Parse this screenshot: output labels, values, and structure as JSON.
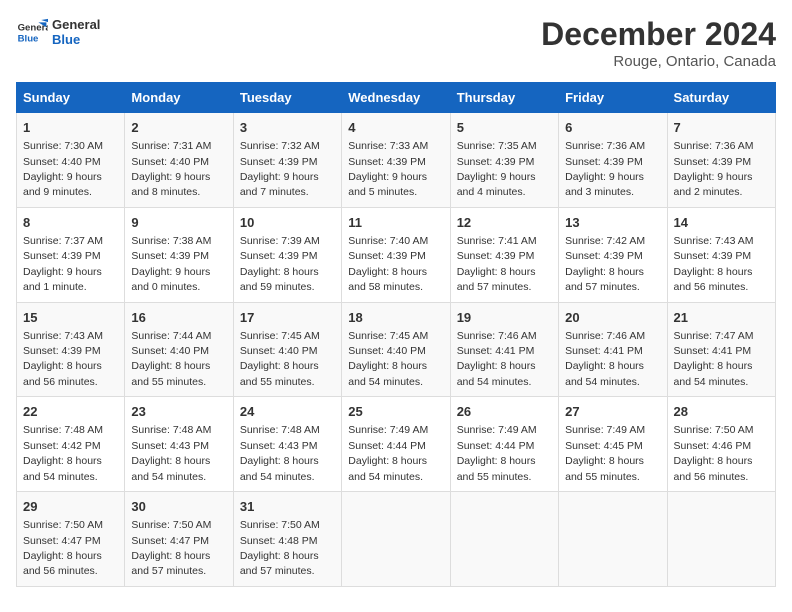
{
  "logo": {
    "line1": "General",
    "line2": "Blue"
  },
  "title": "December 2024",
  "subtitle": "Rouge, Ontario, Canada",
  "days_of_week": [
    "Sunday",
    "Monday",
    "Tuesday",
    "Wednesday",
    "Thursday",
    "Friday",
    "Saturday"
  ],
  "weeks": [
    [
      {
        "day": "1",
        "sunrise": "7:30 AM",
        "sunset": "4:40 PM",
        "daylight": "9 hours and 9 minutes."
      },
      {
        "day": "2",
        "sunrise": "7:31 AM",
        "sunset": "4:40 PM",
        "daylight": "9 hours and 8 minutes."
      },
      {
        "day": "3",
        "sunrise": "7:32 AM",
        "sunset": "4:39 PM",
        "daylight": "9 hours and 7 minutes."
      },
      {
        "day": "4",
        "sunrise": "7:33 AM",
        "sunset": "4:39 PM",
        "daylight": "9 hours and 5 minutes."
      },
      {
        "day": "5",
        "sunrise": "7:35 AM",
        "sunset": "4:39 PM",
        "daylight": "9 hours and 4 minutes."
      },
      {
        "day": "6",
        "sunrise": "7:36 AM",
        "sunset": "4:39 PM",
        "daylight": "9 hours and 3 minutes."
      },
      {
        "day": "7",
        "sunrise": "7:36 AM",
        "sunset": "4:39 PM",
        "daylight": "9 hours and 2 minutes."
      }
    ],
    [
      {
        "day": "8",
        "sunrise": "7:37 AM",
        "sunset": "4:39 PM",
        "daylight": "9 hours and 1 minute."
      },
      {
        "day": "9",
        "sunrise": "7:38 AM",
        "sunset": "4:39 PM",
        "daylight": "9 hours and 0 minutes."
      },
      {
        "day": "10",
        "sunrise": "7:39 AM",
        "sunset": "4:39 PM",
        "daylight": "8 hours and 59 minutes."
      },
      {
        "day": "11",
        "sunrise": "7:40 AM",
        "sunset": "4:39 PM",
        "daylight": "8 hours and 58 minutes."
      },
      {
        "day": "12",
        "sunrise": "7:41 AM",
        "sunset": "4:39 PM",
        "daylight": "8 hours and 57 minutes."
      },
      {
        "day": "13",
        "sunrise": "7:42 AM",
        "sunset": "4:39 PM",
        "daylight": "8 hours and 57 minutes."
      },
      {
        "day": "14",
        "sunrise": "7:43 AM",
        "sunset": "4:39 PM",
        "daylight": "8 hours and 56 minutes."
      }
    ],
    [
      {
        "day": "15",
        "sunrise": "7:43 AM",
        "sunset": "4:39 PM",
        "daylight": "8 hours and 56 minutes."
      },
      {
        "day": "16",
        "sunrise": "7:44 AM",
        "sunset": "4:40 PM",
        "daylight": "8 hours and 55 minutes."
      },
      {
        "day": "17",
        "sunrise": "7:45 AM",
        "sunset": "4:40 PM",
        "daylight": "8 hours and 55 minutes."
      },
      {
        "day": "18",
        "sunrise": "7:45 AM",
        "sunset": "4:40 PM",
        "daylight": "8 hours and 54 minutes."
      },
      {
        "day": "19",
        "sunrise": "7:46 AM",
        "sunset": "4:41 PM",
        "daylight": "8 hours and 54 minutes."
      },
      {
        "day": "20",
        "sunrise": "7:46 AM",
        "sunset": "4:41 PM",
        "daylight": "8 hours and 54 minutes."
      },
      {
        "day": "21",
        "sunrise": "7:47 AM",
        "sunset": "4:41 PM",
        "daylight": "8 hours and 54 minutes."
      }
    ],
    [
      {
        "day": "22",
        "sunrise": "7:48 AM",
        "sunset": "4:42 PM",
        "daylight": "8 hours and 54 minutes."
      },
      {
        "day": "23",
        "sunrise": "7:48 AM",
        "sunset": "4:43 PM",
        "daylight": "8 hours and 54 minutes."
      },
      {
        "day": "24",
        "sunrise": "7:48 AM",
        "sunset": "4:43 PM",
        "daylight": "8 hours and 54 minutes."
      },
      {
        "day": "25",
        "sunrise": "7:49 AM",
        "sunset": "4:44 PM",
        "daylight": "8 hours and 54 minutes."
      },
      {
        "day": "26",
        "sunrise": "7:49 AM",
        "sunset": "4:44 PM",
        "daylight": "8 hours and 55 minutes."
      },
      {
        "day": "27",
        "sunrise": "7:49 AM",
        "sunset": "4:45 PM",
        "daylight": "8 hours and 55 minutes."
      },
      {
        "day": "28",
        "sunrise": "7:50 AM",
        "sunset": "4:46 PM",
        "daylight": "8 hours and 56 minutes."
      }
    ],
    [
      {
        "day": "29",
        "sunrise": "7:50 AM",
        "sunset": "4:47 PM",
        "daylight": "8 hours and 56 minutes."
      },
      {
        "day": "30",
        "sunrise": "7:50 AM",
        "sunset": "4:47 PM",
        "daylight": "8 hours and 57 minutes."
      },
      {
        "day": "31",
        "sunrise": "7:50 AM",
        "sunset": "4:48 PM",
        "daylight": "8 hours and 57 minutes."
      },
      null,
      null,
      null,
      null
    ]
  ]
}
